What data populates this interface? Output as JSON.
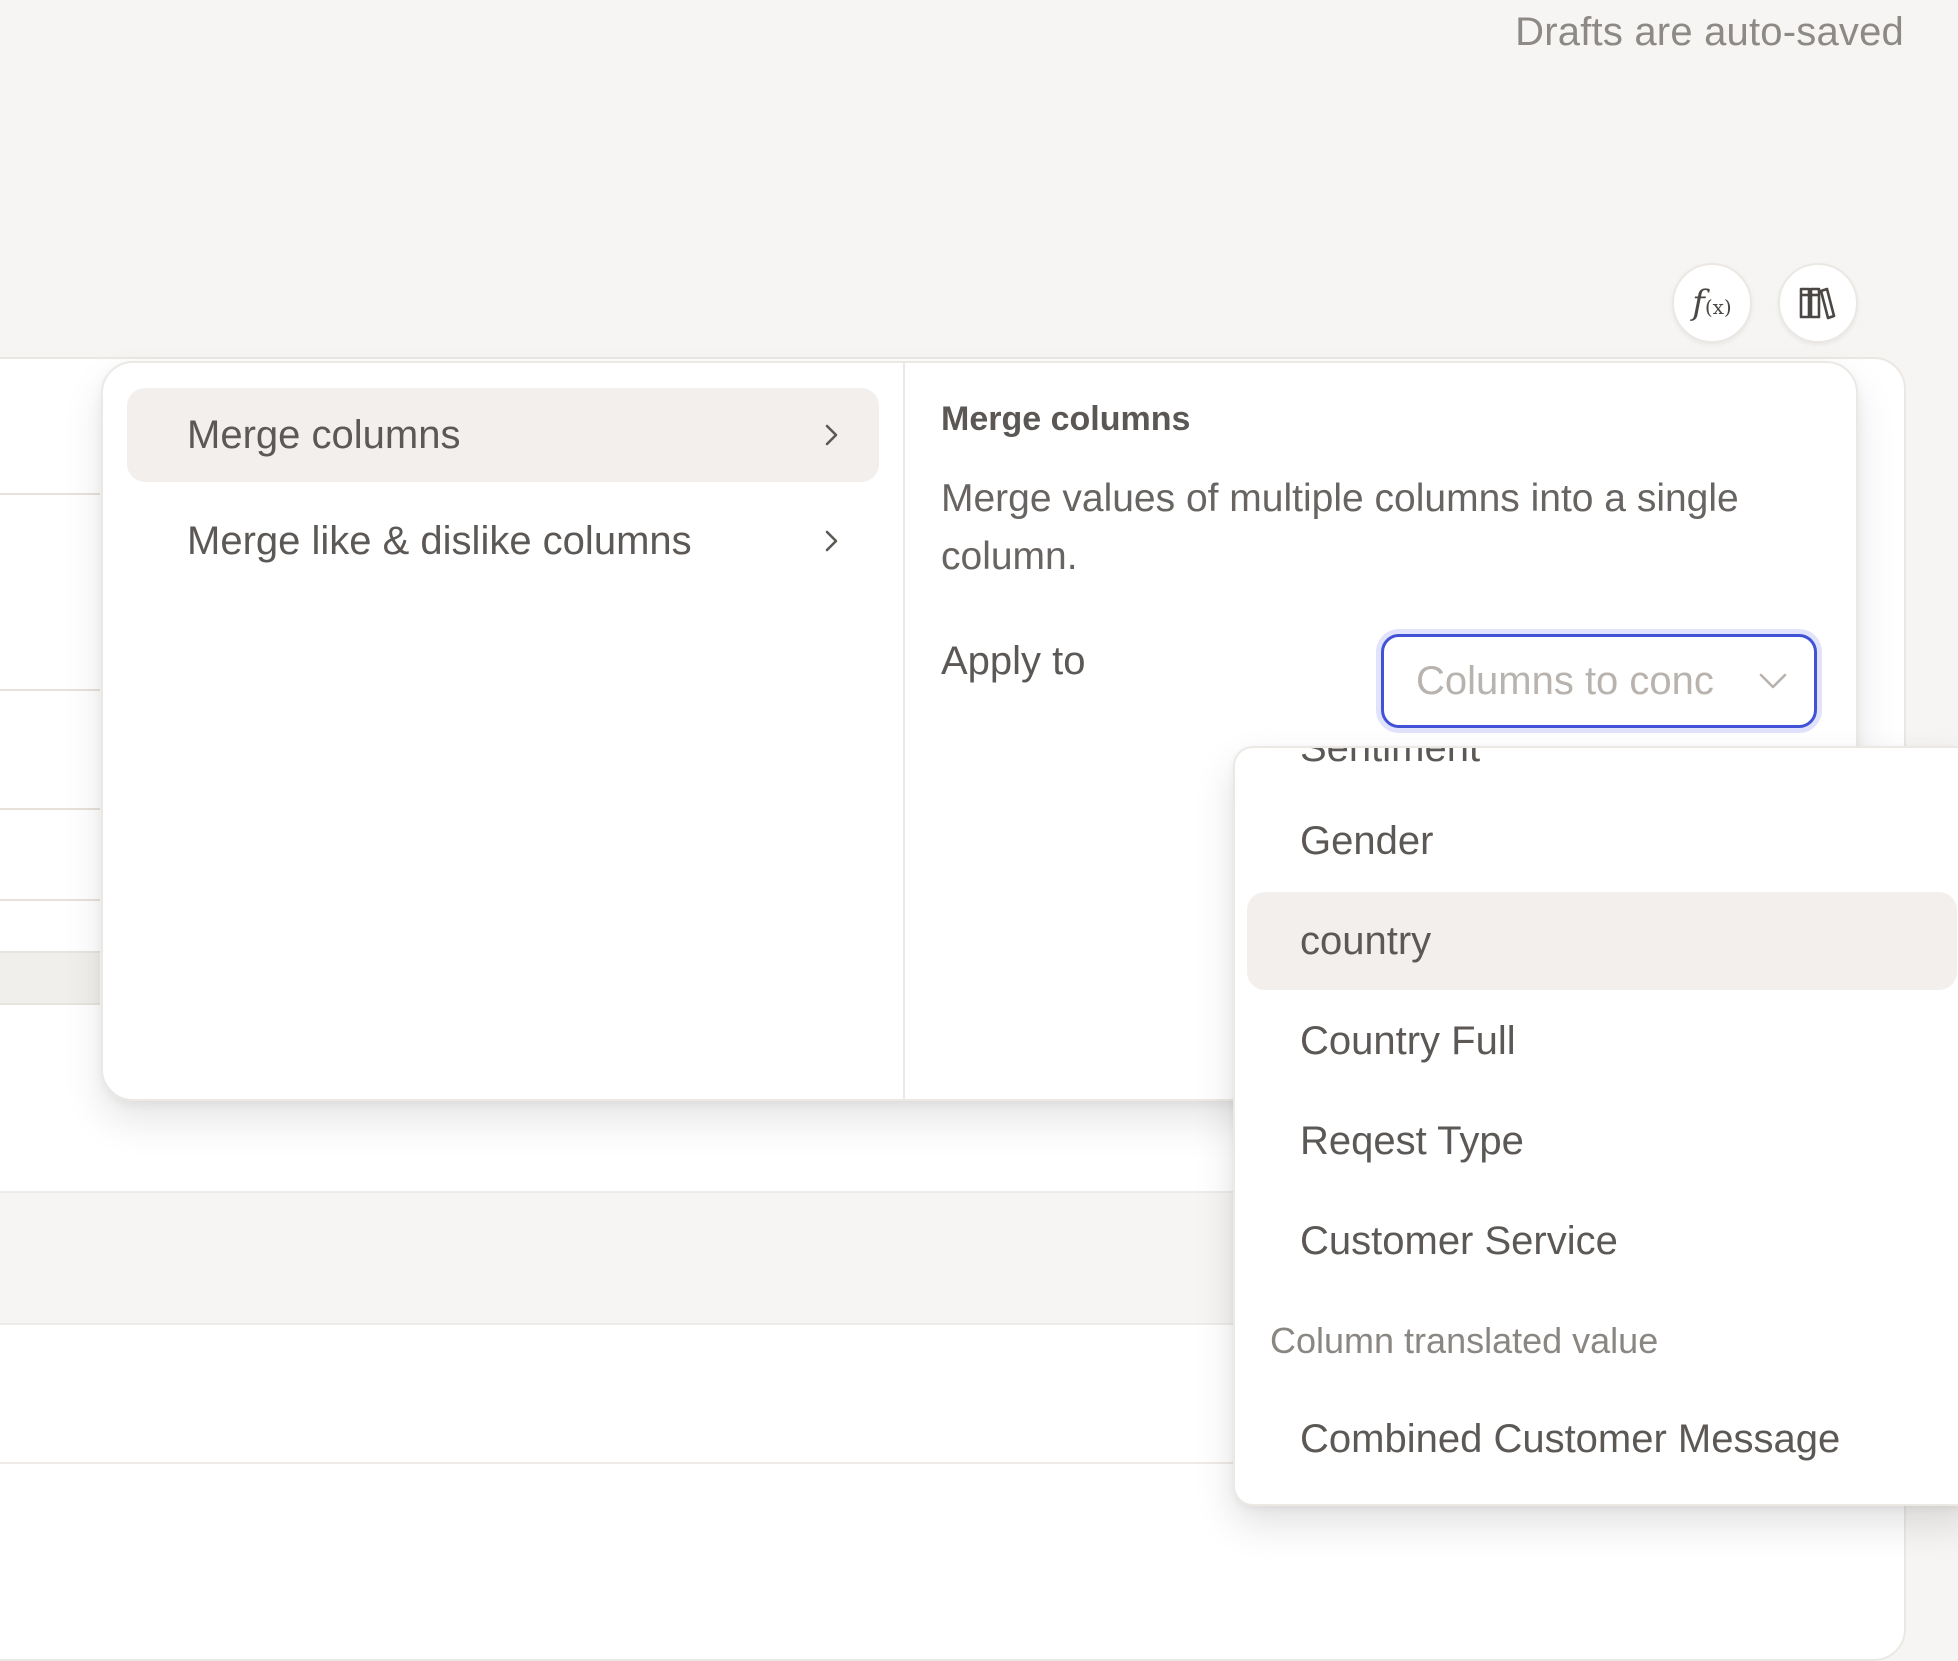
{
  "status": {
    "autosave_text": "Drafts are auto-saved"
  },
  "toolbar": {
    "formula_icon_text": "f",
    "formula_icon_sub": "(x)",
    "icons": [
      "function-icon",
      "library-icon"
    ]
  },
  "transform_menu": {
    "items": [
      {
        "label": "Merge columns",
        "active": true
      },
      {
        "label": "Merge like & dislike columns",
        "active": false
      }
    ]
  },
  "detail_pane": {
    "title": "Merge columns",
    "description": "Merge values of multiple columns into a single column.",
    "apply_label": "Apply to",
    "select_placeholder": "Columns to conc"
  },
  "dropdown": {
    "clipped_option": "Sentiment",
    "options": [
      {
        "label": "Gender",
        "highlighted": false
      },
      {
        "label": "country",
        "highlighted": true
      },
      {
        "label": "Country Full",
        "highlighted": false
      },
      {
        "label": "Reqest Type",
        "highlighted": false
      },
      {
        "label": "Customer Service",
        "highlighted": false
      }
    ],
    "group_label": "Column translated value",
    "group_options": [
      {
        "label": "Combined Customer Message"
      }
    ]
  },
  "colors": {
    "focus_ring": "#4252d6",
    "background": "#f6f5f3",
    "highlight": "#f2efec"
  }
}
